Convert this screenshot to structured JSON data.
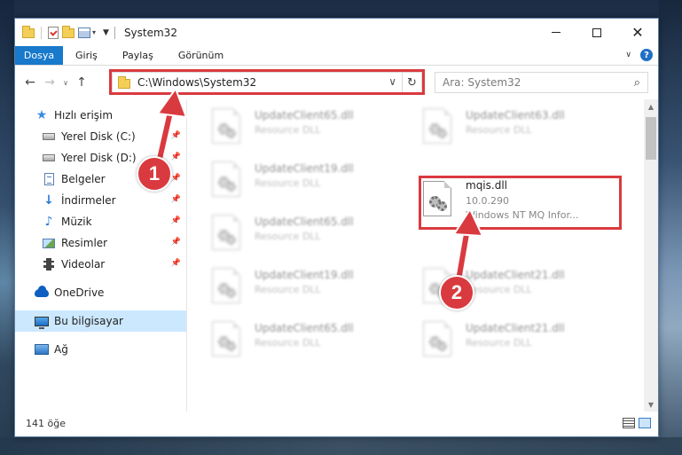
{
  "window": {
    "title": "System32"
  },
  "ribbon": {
    "tabs": [
      {
        "label": "Dosya"
      },
      {
        "label": "Giriş"
      },
      {
        "label": "Paylaş"
      },
      {
        "label": "Görünüm"
      }
    ]
  },
  "address": {
    "path": "C:\\Windows\\System32",
    "search_placeholder": "Ara: System32"
  },
  "nav_pane": {
    "items": [
      {
        "label": "Hızlı erişim"
      },
      {
        "label": "Yerel Disk (C:)"
      },
      {
        "label": "Yerel Disk (D:)"
      },
      {
        "label": "Belgeler"
      },
      {
        "label": "İndirmeler"
      },
      {
        "label": "Müzik"
      },
      {
        "label": "Resimler"
      },
      {
        "label": "Videolar"
      },
      {
        "label": "OneDrive"
      },
      {
        "label": "Bu bilgisayar"
      },
      {
        "label": "Ağ"
      }
    ]
  },
  "files": [
    {
      "name": "UpdateClient65.dll",
      "desc": "Resource DLL"
    },
    {
      "name": "UpdateClient63.dll",
      "desc": "Resource DLL"
    },
    {
      "name": "UpdateClient19.dll",
      "desc": "Resource DLL"
    },
    {
      "name": "mqis.dll",
      "version": "10.0.290",
      "desc": "Windows NT MQ Infor..."
    },
    {
      "name": "UpdateClient65.dll",
      "desc": "Resource DLL"
    },
    {
      "name": "UpdateClient65.dll",
      "desc": "Resource DLL"
    },
    {
      "name": "UpdateClient19.dll",
      "desc": "Resource DLL"
    },
    {
      "name": "UpdateClient21.dll",
      "desc": "Resource DLL"
    },
    {
      "name": "UpdateClient65.dll",
      "desc": "Resource DLL"
    },
    {
      "name": "UpdateClient21.dll",
      "desc": "Resource DLL"
    }
  ],
  "status": {
    "count": "141 öğe"
  },
  "annotations": {
    "step1": "1",
    "step2": "2",
    "color": "#d93a3f"
  },
  "colors": {
    "accent": "#1979ca",
    "selection": "#cce8ff"
  }
}
